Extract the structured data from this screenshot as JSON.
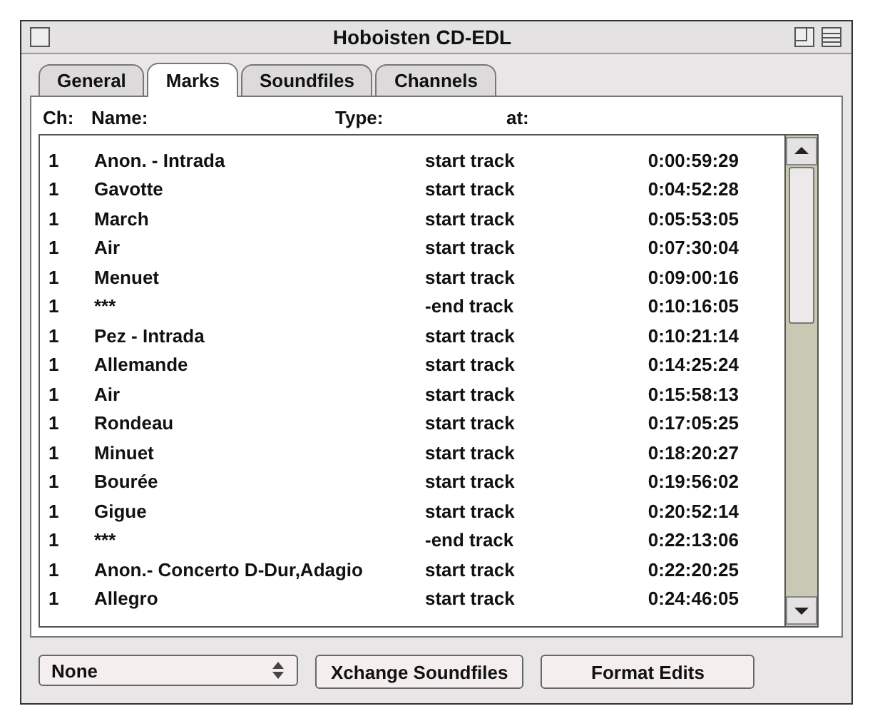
{
  "window": {
    "title": "Hoboisten CD-EDL"
  },
  "tabs": [
    {
      "label": "General",
      "selected": false
    },
    {
      "label": "Marks",
      "selected": true
    },
    {
      "label": "Soundfiles",
      "selected": false
    },
    {
      "label": "Channels",
      "selected": false
    }
  ],
  "table": {
    "columns": [
      "Ch:",
      "Name:",
      "Type:",
      "at:"
    ],
    "rows": [
      [
        "1",
        "Anon. - Intrada",
        "start track",
        "0:00:59:29"
      ],
      [
        "1",
        "Gavotte",
        "start track",
        "0:04:52:28"
      ],
      [
        "1",
        "March",
        "start track",
        "0:05:53:05"
      ],
      [
        "1",
        "Air",
        "start track",
        "0:07:30:04"
      ],
      [
        "1",
        "Menuet",
        "start track",
        "0:09:00:16"
      ],
      [
        "1",
        "***",
        "-end track",
        "0:10:16:05"
      ],
      [
        "1",
        "Pez - Intrada",
        "start track",
        "0:10:21:14"
      ],
      [
        "1",
        "Allemande",
        "start track",
        "0:14:25:24"
      ],
      [
        "1",
        "Air",
        "start track",
        "0:15:58:13"
      ],
      [
        "1",
        "Rondeau",
        "start track",
        "0:17:05:25"
      ],
      [
        "1",
        "Minuet",
        "start track",
        "0:18:20:27"
      ],
      [
        "1",
        "Bourée",
        "start track",
        "0:19:56:02"
      ],
      [
        "1",
        "Gigue",
        "start track",
        "0:20:52:14"
      ],
      [
        "1",
        "***",
        "-end track",
        "0:22:13:06"
      ],
      [
        "1",
        "Anon.- Concerto D-Dur,Adagio",
        "start track",
        "0:22:20:25"
      ],
      [
        "1",
        "Allegro",
        "start track",
        "0:24:46:05"
      ]
    ]
  },
  "popup": {
    "value": "None"
  },
  "buttons": [
    "Xchange Soundfiles",
    "Format Edits"
  ]
}
